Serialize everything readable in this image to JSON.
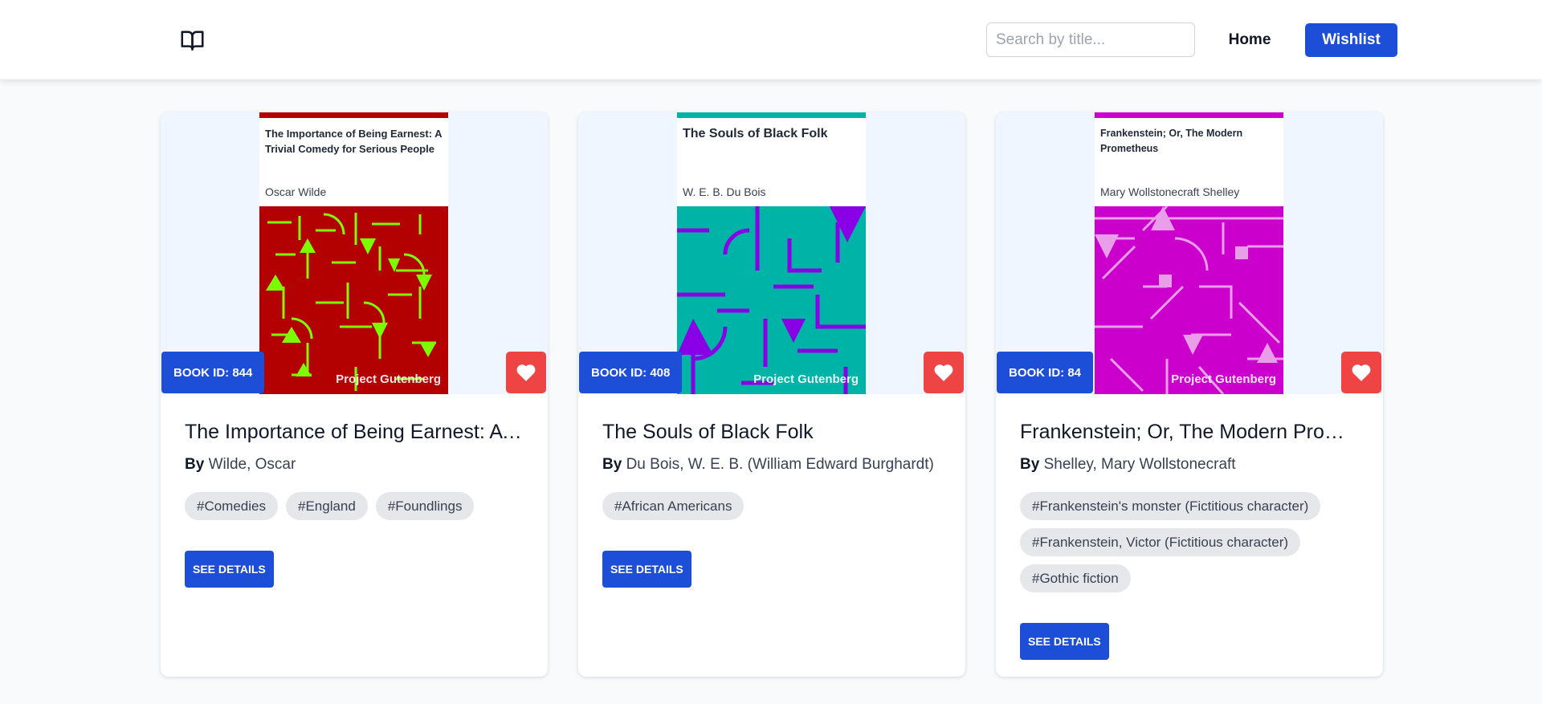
{
  "header": {
    "logo_icon": "book-icon",
    "search_placeholder": "Search by title...",
    "home_label": "Home",
    "wishlist_label": "Wishlist"
  },
  "colors": {
    "primary": "#1d4ed8",
    "heart": "#ef4444",
    "tag_bg": "#e5e7eb",
    "cover_area_bg": "#eff6ff"
  },
  "cards": [
    {
      "badge": "BOOK ID: 844",
      "title": "The Importance of Being Earnest: A Trivial Comedy for Serious People",
      "by_label": "By",
      "author": "Wilde, Oscar",
      "tags": [
        "#Comedies",
        "#England",
        "#Foundlings"
      ],
      "details_label": "SEE DETAILS",
      "cover": {
        "title": "The Importance of Being Earnest: A Trivial Comedy for Serious People",
        "author": "Oscar Wilde",
        "brand": "Project Gutenberg",
        "bg_color": "#b30000",
        "pattern_color": "#7cfc00"
      }
    },
    {
      "badge": "BOOK ID: 408",
      "title": "The Souls of Black Folk",
      "by_label": "By",
      "author": "Du Bois, W. E. B. (William Edward Burghardt)",
      "tags": [
        "#African Americans"
      ],
      "details_label": "SEE DETAILS",
      "cover": {
        "title": "The Souls of Black Folk",
        "author": "W. E. B. Du Bois",
        "brand": "Project Gutenberg",
        "bg_color": "#00b3a7",
        "pattern_color": "#8a00e6"
      }
    },
    {
      "badge": "BOOK ID: 84",
      "title": "Frankenstein; Or, The Modern Prometheus",
      "by_label": "By",
      "author": "Shelley, Mary Wollstonecraft",
      "tags": [
        "#Frankenstein's monster (Fictitious character)",
        "#Frankenstein, Victor (Fictitious character)",
        "#Gothic fiction"
      ],
      "details_label": "SEE DETAILS",
      "cover": {
        "title": "Frankenstein; Or, The Modern Prometheus",
        "author": "Mary Wollstonecraft Shelley",
        "brand": "Project Gutenberg",
        "bg_color": "#cc00cc",
        "pattern_color": "#e99ee9"
      }
    }
  ]
}
